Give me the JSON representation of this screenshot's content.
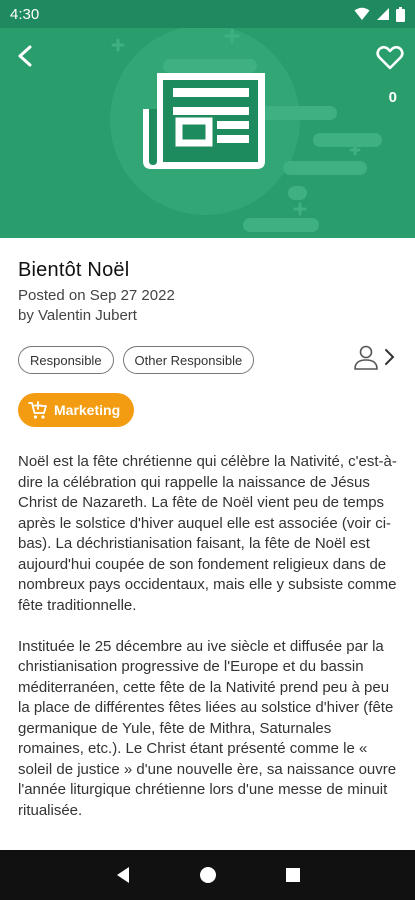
{
  "status_bar": {
    "time": "4:30",
    "icons": [
      "wifi-icon",
      "signal-icon",
      "battery-icon"
    ]
  },
  "header": {
    "back_icon": "chevron-left-icon",
    "favorite_icon": "heart-outline-icon",
    "favorite_count": "0",
    "illustration": "newspaper-icon",
    "background_color": "#2a9d6c"
  },
  "article": {
    "title": "Bientôt Noël",
    "posted": "Posted on Sep 27 2022",
    "author": "by Valentin Jubert",
    "tags": [
      "Responsible",
      "Other Responsible"
    ],
    "category": {
      "label": "Marketing",
      "icon": "cart-add-icon",
      "color": "#f39c12"
    },
    "paragraphs": [
      "Noël est la fête chrétienne qui célèbre la Nativité, c'est-à-dire la célébration qui rappelle la naissance de Jésus Christ de Nazareth. La fête de Noël vient peu de temps après le solstice d'hiver auquel elle est associée (voir ci-bas). La déchristianisation faisant, la fête de Noël est aujourd'hui coupée de son fondement religieux dans de nombreux pays occidentaux, mais elle y subsiste comme fête traditionnelle.",
      "Instituée le 25 décembre au ive siècle et diffusée par la christianisation progressive de l'Europe et du bassin méditerranéen, cette fête de la Nativité prend peu à peu la place de différentes fêtes liées au solstice d'hiver (fête germanique de Yule, fête de Mithra, Saturnales romaines, etc.). Le Christ étant présenté comme le « soleil de justice » d'une nouvelle ère, sa naissance ouvre l'année liturgique chrétienne lors d'une messe de minuit ritualisée."
    ]
  },
  "responsible_icon": "person-icon",
  "nav_bar": {
    "buttons": [
      "back-triangle-icon",
      "home-circle-icon",
      "recents-square-icon"
    ]
  }
}
